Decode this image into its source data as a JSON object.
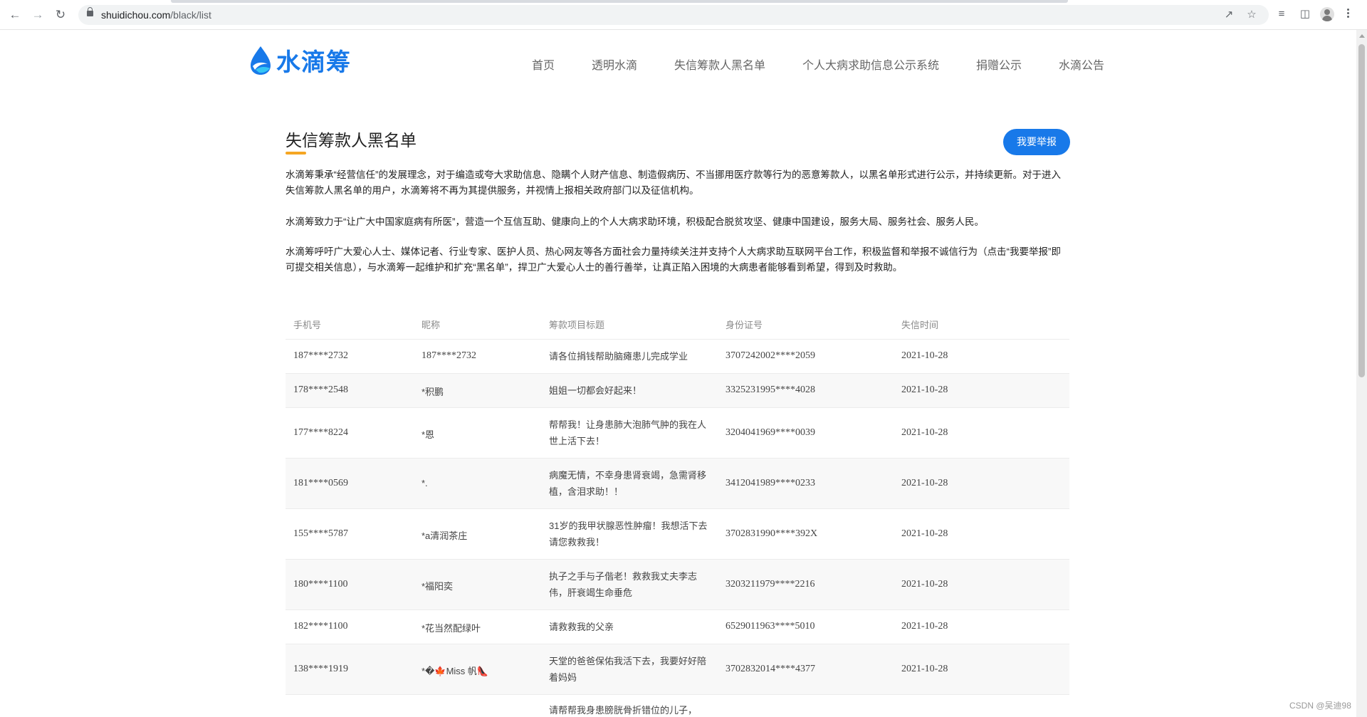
{
  "browser": {
    "url_host": "shuidichou.com",
    "url_path": "/black/list"
  },
  "site": {
    "logo_text": "水滴筹",
    "nav": [
      "首页",
      "透明水滴",
      "失信筹款人黑名单",
      "个人大病求助信息公示系统",
      "捐赠公示",
      "水滴公告"
    ]
  },
  "page": {
    "title": "失信筹款人黑名单",
    "report_button": "我要举报",
    "paragraphs": [
      "水滴筹秉承“经营信任”的发展理念，对于编造或夸大求助信息、隐瞒个人财产信息、制造假病历、不当挪用医疗款等行为的恶意筹款人，以黑名单形式进行公示，并持续更新。对于进入失信筹款人黑名单的用户，水滴筹将不再为其提供服务，并视情上报相关政府部门以及征信机构。",
      "水滴筹致力于“让广大中国家庭病有所医”，营造一个互信互助、健康向上的个人大病求助环境，积极配合脱贫攻坚、健康中国建设，服务大局、服务社会、服务人民。",
      "水滴筹呼吁广大爱心人士、媒体记者、行业专家、医护人员、热心网友等各方面社会力量持续关注并支持个人大病求助互联网平台工作，积极监督和举报不诚信行为（点击“我要举报”即可提交相关信息），与水滴筹一起维护和扩充“黑名单”，捍卫广大爱心人士的善行善举，让真正陷入困境的大病患者能够看到希望，得到及时救助。"
    ]
  },
  "table": {
    "headers": [
      "手机号",
      "昵称",
      "筹款项目标题",
      "身份证号",
      "失信时间"
    ],
    "rows": [
      {
        "phone": "187****2732",
        "nickname": "187****2732",
        "title": "请各位捐钱帮助脑瘫患儿完成学业",
        "id": "3707242002****2059",
        "date": "2021-10-28"
      },
      {
        "phone": "178****2548",
        "nickname": "*积鹏",
        "title": "姐姐一切都会好起来！",
        "id": "3325231995****4028",
        "date": "2021-10-28"
      },
      {
        "phone": "177****8224",
        "nickname": "*恩",
        "title": "帮帮我！让身患肺大泡肺气肿的我在人世上活下去！",
        "id": "3204041969****0039",
        "date": "2021-10-28"
      },
      {
        "phone": "181****0569",
        "nickname": "*.",
        "title": "病魔无情，不幸身患肾衰竭，急需肾移植，含泪求助！！",
        "id": "3412041989****0233",
        "date": "2021-10-28"
      },
      {
        "phone": "155****5787",
        "nickname": "*a清润茶庄",
        "title": "31岁的我甲状腺恶性肿瘤！我想活下去请您救救我！",
        "id": "3702831990****392X",
        "date": "2021-10-28"
      },
      {
        "phone": "180****1100",
        "nickname": "*福阳奕",
        "title": "执子之手与子偕老！救救我丈夫李志伟，肝衰竭生命垂危",
        "id": "3203211979****2216",
        "date": "2021-10-28"
      },
      {
        "phone": "182****1100",
        "nickname": "*花当然配绿叶",
        "title": "请救救我的父亲",
        "id": "6529011963****5010",
        "date": "2021-10-28"
      },
      {
        "phone": "138****1919",
        "nickname": "*�🍁Miss 帆👠",
        "title": "天堂的爸爸保佑我活下去，我要好好陪着妈妈",
        "id": "3702832014****4377",
        "date": "2021-10-28"
      },
      {
        "phone": "",
        "nickname": "",
        "title": "请帮帮我身患膀胱骨折错位的儿子，",
        "id": "",
        "date": ""
      }
    ]
  },
  "watermark": "CSDN @吴迪98",
  "colors": {
    "brand": "#1879e9",
    "accent_underline": "#f5a623"
  }
}
